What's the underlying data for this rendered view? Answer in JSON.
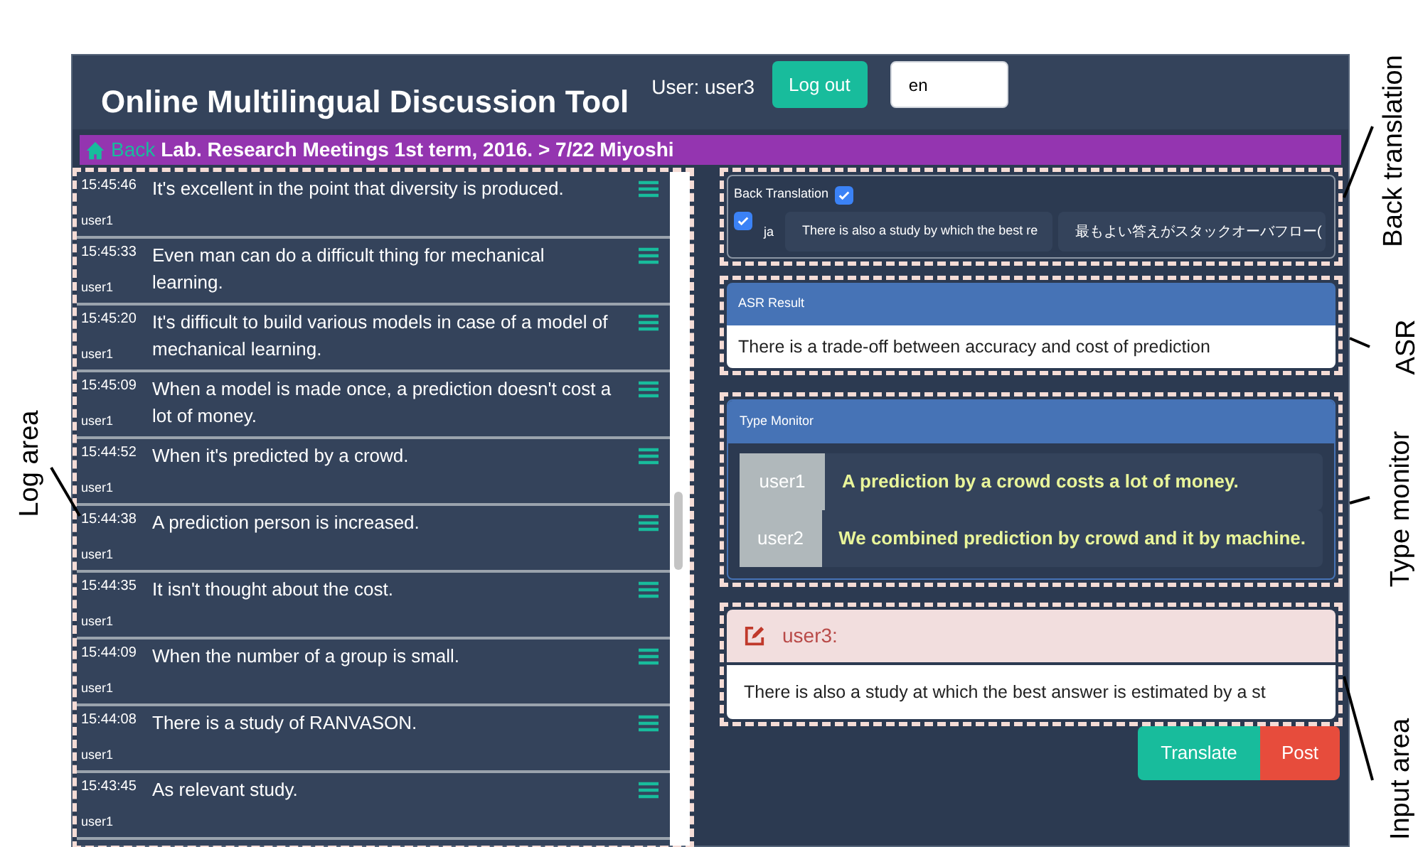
{
  "header": {
    "title": "Online Multilingual Discussion Tool",
    "user_label": "User: user3",
    "logout": "Log out",
    "language": "en"
  },
  "breadcrumb": {
    "back": "Back",
    "path": "Lab. Research Meetings 1st term, 2016. > 7/22 Miyoshi"
  },
  "log": [
    {
      "time": "15:45:46",
      "user": "user1",
      "text": "It's excellent in the point that diversity is produced."
    },
    {
      "time": "15:45:33",
      "user": "user1",
      "text": "Even man can do a difficult thing for mechanical learning."
    },
    {
      "time": "15:45:20",
      "user": "user1",
      "text": "It's difficult to build various models in case of a model of mechanical learning."
    },
    {
      "time": "15:45:09",
      "user": "user1",
      "text": "When a model is made once, a prediction doesn't cost a lot of money."
    },
    {
      "time": "15:44:52",
      "user": "user1",
      "text": "When it's predicted by a crowd."
    },
    {
      "time": "15:44:38",
      "user": "user1",
      "text": "A prediction person is increased."
    },
    {
      "time": "15:44:35",
      "user": "user1",
      "text": "It isn't thought about the cost."
    },
    {
      "time": "15:44:09",
      "user": "user1",
      "text": "When the number of a group is small."
    },
    {
      "time": "15:44:08",
      "user": "user1",
      "text": "There is a study of RANVASON."
    },
    {
      "time": "15:43:45",
      "user": "user1",
      "text": "As relevant study."
    }
  ],
  "back_translation": {
    "title": "Back Translation",
    "checked": true,
    "rows": [
      {
        "checked": true,
        "lang": "ja",
        "source": "There is also a study by which the best re",
        "translation": "最もよい答えがスタックオーバフロー("
      }
    ]
  },
  "asr": {
    "title": "ASR Result",
    "text": "There is a trade-off between accuracy and cost of prediction"
  },
  "type_monitor": {
    "title": "Type Monitor",
    "entries": [
      {
        "user": "user1",
        "text": "A prediction by a crowd costs a lot of money."
      },
      {
        "user": "user2",
        "text": "We combined prediction by crowd and it by machine."
      }
    ]
  },
  "input": {
    "user": "user3:",
    "value": "There is also a study at which the best answer is estimated by a st",
    "buttons": [
      "Translate",
      "Post"
    ]
  },
  "annotations": [
    "Log area",
    "Back translation",
    "ASR",
    "Type monitor",
    "Input area"
  ]
}
